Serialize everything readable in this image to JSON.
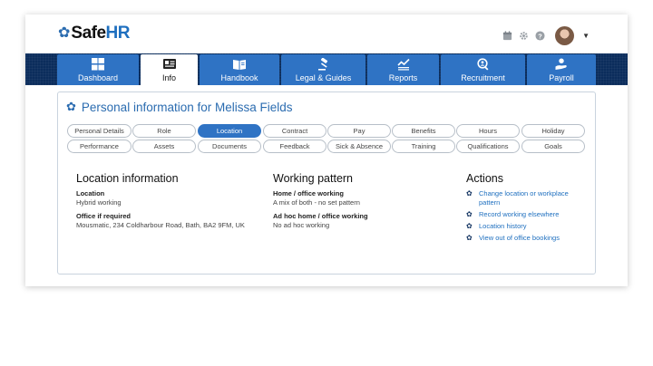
{
  "app": {
    "logo_safe": "Safe",
    "logo_hr": "HR"
  },
  "topbar": {
    "icons": [
      "calendar-icon",
      "gear-icon",
      "help-icon"
    ]
  },
  "tabs": [
    {
      "label": "Dashboard",
      "icon": "grid-icon"
    },
    {
      "label": "Info",
      "icon": "id-card-icon",
      "active": true
    },
    {
      "label": "Handbook",
      "icon": "book-icon"
    },
    {
      "label": "Legal & Guides",
      "icon": "gavel-icon"
    },
    {
      "label": "Reports",
      "icon": "chart-icon"
    },
    {
      "label": "Recruitment",
      "icon": "search-person-icon"
    },
    {
      "label": "Payroll",
      "icon": "payroll-icon"
    }
  ],
  "panel": {
    "title": "Personal information for Melissa Fields"
  },
  "subtabs": {
    "row1": [
      "Personal Details",
      "Role",
      "Location",
      "Contract",
      "Pay",
      "Benefits",
      "Hours",
      "Holiday"
    ],
    "row2": [
      "Performance",
      "Assets",
      "Documents",
      "Feedback",
      "Sick & Absence",
      "Training",
      "Qualifications",
      "Goals"
    ],
    "active": "Location"
  },
  "location": {
    "title": "Location information",
    "fields": [
      {
        "label": "Location",
        "value": "Hybrid working"
      },
      {
        "label": "Office if required",
        "value": "Mousmatic, 234 Coldharbour Road, Bath, BA2 9FM, UK"
      }
    ]
  },
  "working": {
    "title": "Working pattern",
    "fields": [
      {
        "label": "Home / office working",
        "value": "A mix of both - no set pattern"
      },
      {
        "label": "Ad hoc home / office working",
        "value": "No ad hoc working"
      }
    ]
  },
  "actions": {
    "title": "Actions",
    "items": [
      "Change location or workplace pattern",
      "Record working elsewhere",
      "Location history",
      "View out of office bookings"
    ]
  },
  "colors": {
    "nav_dark": "#0b2d5c",
    "tab_blue": "#2f73c4",
    "link": "#1e6fbf"
  }
}
